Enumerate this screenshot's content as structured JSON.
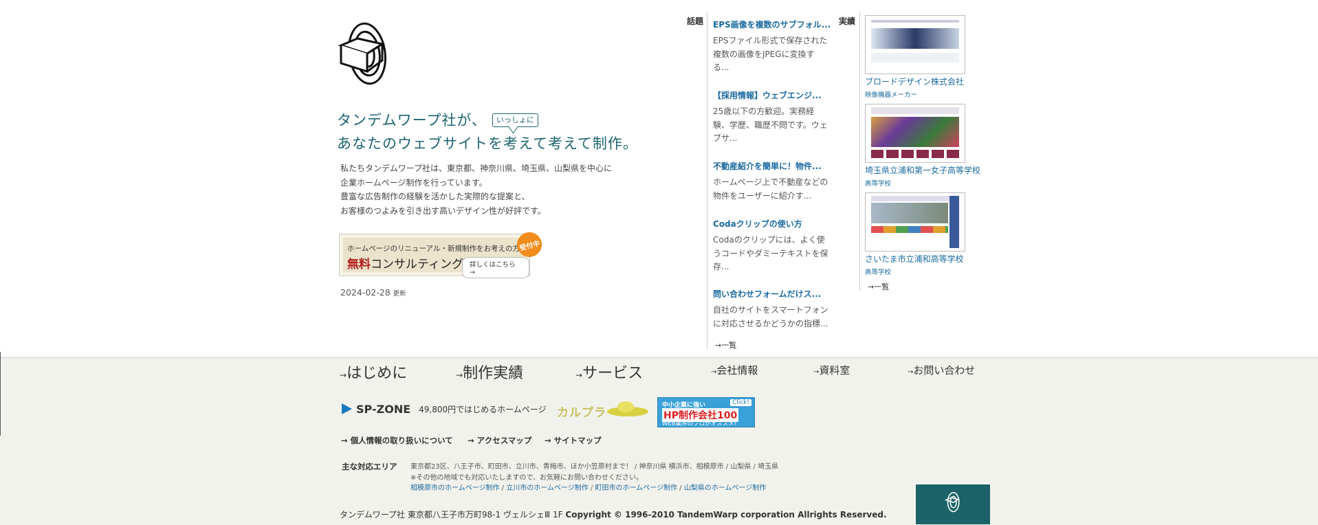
{
  "hero": {
    "tagline_line1": "タンデムワープ社が、",
    "bubble": "いっしょに",
    "tagline_line2": "あなたのウェブサイトを考えて考えて制作。",
    "intro": [
      "私たちタンデムワープ社は、東京都、神奈川県、埼玉県、山梨県を中心に",
      "企業ホームページ制作を行っています。",
      "豊富な広告制作の経験を活かした実際的な提案と、",
      "お客様のつよみを引き出す高いデザイン性が好評です。"
    ],
    "consult_line1": "ホームページのリニューアル・新規制作をお考えの方",
    "consult_free": "無料",
    "consult_main": "コンサルティング",
    "consult_more": "詳しくはこちら",
    "badge": "受付中",
    "updated_date": "2024-02-28",
    "updated_label": "更新"
  },
  "topics": {
    "label": "話題",
    "items": [
      {
        "title": "EPS画像を複数のサブフォル...",
        "desc": "EPSファイル形式で保存された複数の画像をJPEGに変換する..."
      },
      {
        "title": "【採用情報】ウェブエンジ...",
        "desc": "25歳以下の方歓迎。実務経験、学歴、職歴不問です。ウェブサ..."
      },
      {
        "title": "不動産紹介を簡単に！物件...",
        "desc": "ホームページ上で不動産などの物件をユーザーに紹介す..."
      },
      {
        "title": "Codaクリップの使い方",
        "desc": "Codaのクリップには、よく使うコードやダミーテキストを保存..."
      },
      {
        "title": "問い合わせフォームだけス...",
        "desc": "自社のサイトをスマートフォンに対応させるかどうかの指標..."
      }
    ],
    "more": "一覧"
  },
  "works": {
    "label": "実績",
    "items": [
      {
        "name": "ブロードデザイン株式会社",
        "category": "映像機器メーカー"
      },
      {
        "name": "埼玉県立浦和第一女子高等学校",
        "category": "高等学校"
      },
      {
        "name": "さいたま市立浦和高等学校",
        "category": "高等学校"
      }
    ],
    "more": "一覧"
  },
  "footer": {
    "nav": [
      "はじめに",
      "制作実績",
      "サービス",
      "会社情報",
      "資料室",
      "お問い合わせ"
    ],
    "spzone": "SP-ZONE",
    "spzone_sub": "49,800円ではじめるホームページ",
    "karupura": "カルプラ",
    "hp100_line1": "中小企業に強い",
    "hp100_click": "Click!",
    "hp100_line2": "HP制作会社100",
    "hp100_line3": "WEB業界のプロがオススメ!",
    "subnav": [
      "個人情報の取り扱いについて",
      "アクセスマップ",
      "サイトマップ"
    ],
    "area_label": "主な対応エリア",
    "area_line1": "東京都23区、八王子市、町田市、立川市、青梅市、ほか小笠原村まで！ / 神奈川県 横浜市、相模原市 / 山梨県 / 埼玉県",
    "area_line2": "※その他の地域でも対応いたしますので、お気軽にお問い合わせください。",
    "area_links": [
      "相模原市のホームページ制作",
      "立川市のホームページ制作",
      "町田市のホームページ制作",
      "山梨県のホームページ制作"
    ],
    "company": "タンデムワープ社",
    "address": "東京都八王子市万町98-1 ヴェルシェⅢ 1F",
    "copyright": "Copyright © 1996-2010 TandemWarp corporation Allrights Reserved."
  },
  "colors": {
    "accent": "#1c6470",
    "link": "#1a6aa0",
    "footer_bg": "#f2f2ec",
    "badge": "#f28c1c"
  }
}
